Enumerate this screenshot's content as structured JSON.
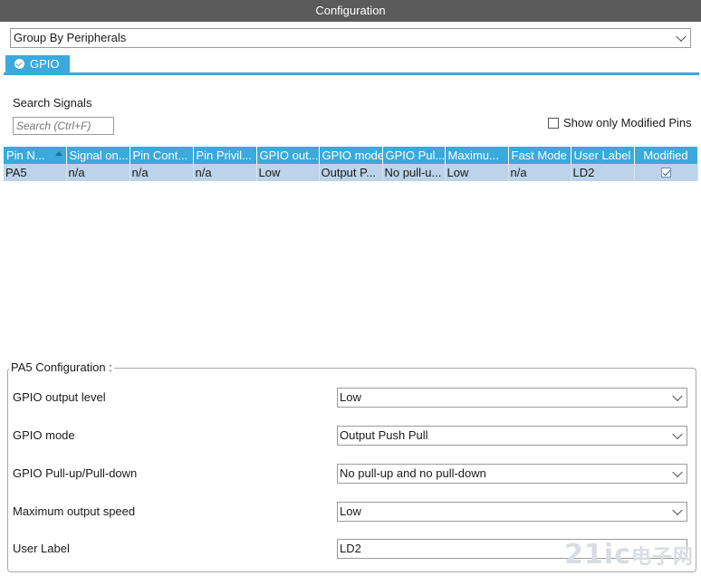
{
  "window": {
    "title": "Configuration"
  },
  "grouping": {
    "selected": "Group By Peripherals"
  },
  "tabs": [
    {
      "label": "GPIO"
    }
  ],
  "search": {
    "label": "Search Signals",
    "placeholder": "Search (Ctrl+F)"
  },
  "filter": {
    "show_modified_label": "Show only Modified Pins",
    "checked": false
  },
  "table": {
    "columns": [
      "Pin N...",
      "Signal on...",
      "Pin Cont...",
      "Pin Privil...",
      "GPIO out...",
      "GPIO mode",
      "GPIO Pul...",
      "Maximu...",
      "Fast Mode",
      "User Label",
      "Modified"
    ],
    "rows": [
      {
        "pin": "PA5",
        "signal": "n/a",
        "pin_context": "n/a",
        "pin_privilege": "n/a",
        "gpio_output": "Low",
        "gpio_mode": "Output P...",
        "gpio_pull": "No pull-u...",
        "max_speed": "Low",
        "fast_mode": "n/a",
        "user_label": "LD2",
        "modified": true
      }
    ]
  },
  "config": {
    "title": "PA5 Configuration :",
    "fields": [
      {
        "label": "GPIO output level",
        "value": "Low"
      },
      {
        "label": "GPIO mode",
        "value": "Output Push Pull"
      },
      {
        "label": "GPIO Pull-up/Pull-down",
        "value": "No pull-up and no pull-down"
      },
      {
        "label": "Maximum output speed",
        "value": "Low"
      },
      {
        "label": "User Label",
        "value": "LD2"
      }
    ]
  },
  "watermark": {
    "main": "21ic",
    "sub": "电子网"
  },
  "colors": {
    "accent": "#3aa9dc",
    "titlebar": "#5b5b5b",
    "selected_row": "#bcd3ea"
  }
}
